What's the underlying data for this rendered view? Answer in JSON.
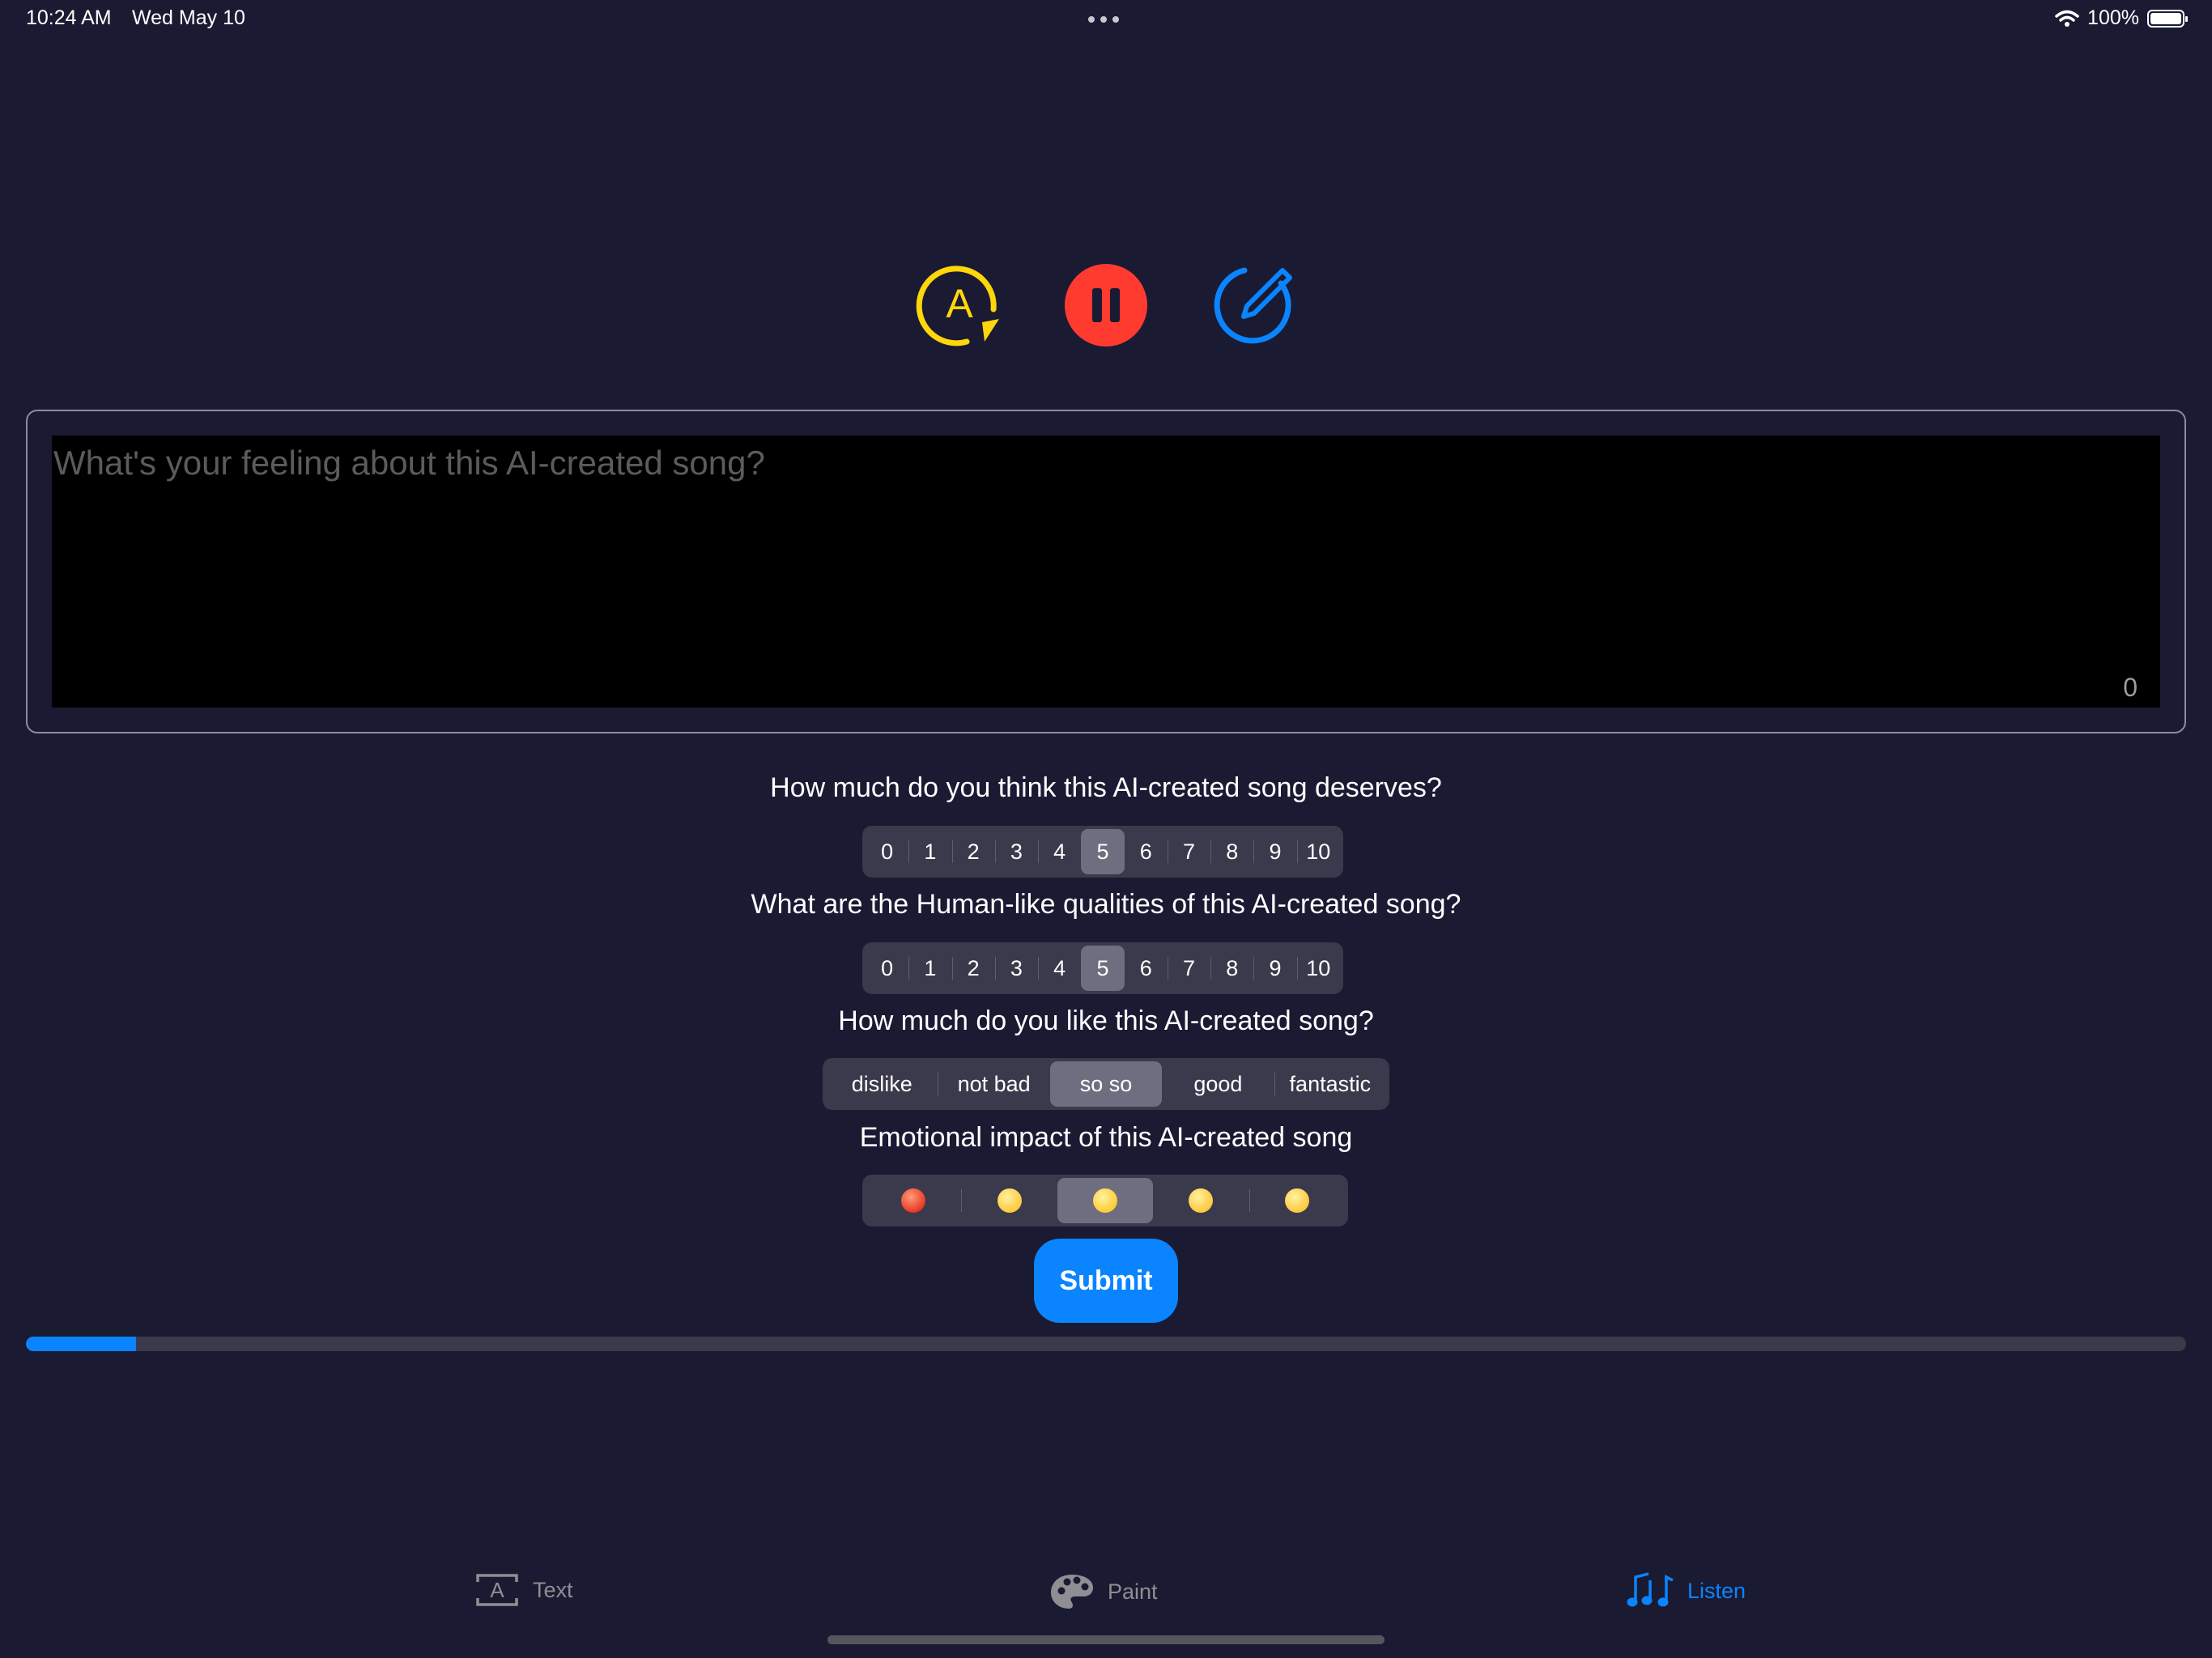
{
  "status_bar": {
    "time": "10:24 AM",
    "date": "Wed May 10",
    "battery": "100%"
  },
  "controls": {
    "auto_icon": "autoplay-a-icon",
    "pause_icon": "pause-icon",
    "edit_icon": "edit-pencil-icon",
    "colors": {
      "auto": "#ffd60a",
      "pause": "#ff3b30",
      "edit": "#0a84ff"
    }
  },
  "feeling": {
    "placeholder": "What's your feeling about this AI-created song?",
    "value": "",
    "char_count": "0"
  },
  "questions": {
    "deserves": {
      "label": "How much do you think this AI-created song deserves?",
      "options": [
        "0",
        "1",
        "2",
        "3",
        "4",
        "5",
        "6",
        "7",
        "8",
        "9",
        "10"
      ],
      "selected_index": 5
    },
    "human_like": {
      "label": "What are the Human-like qualities of this AI-created song?",
      "options": [
        "0",
        "1",
        "2",
        "3",
        "4",
        "5",
        "6",
        "7",
        "8",
        "9",
        "10"
      ],
      "selected_index": 5
    },
    "like": {
      "label": "How much do you like this AI-created song?",
      "options": [
        "dislike",
        "not bad",
        "so so",
        "good",
        "fantastic"
      ],
      "selected_index": 2
    },
    "emotion": {
      "label": "Emotional impact of this AI-created song",
      "options": [
        "angry-face-icon",
        "crying-face-icon",
        "grinning-face-icon",
        "kissing-face-icon",
        "sunglasses-face-icon"
      ],
      "selected_index": 2
    }
  },
  "submit": {
    "label": "Submit"
  },
  "progress": {
    "value_percent": 5.1,
    "color": "#0a84ff"
  },
  "tabs": [
    {
      "label": "Text",
      "icon": "text-box-icon",
      "active": false
    },
    {
      "label": "Paint",
      "icon": "palette-icon",
      "active": false
    },
    {
      "label": "Listen",
      "icon": "music-notes-icon",
      "active": true
    }
  ]
}
